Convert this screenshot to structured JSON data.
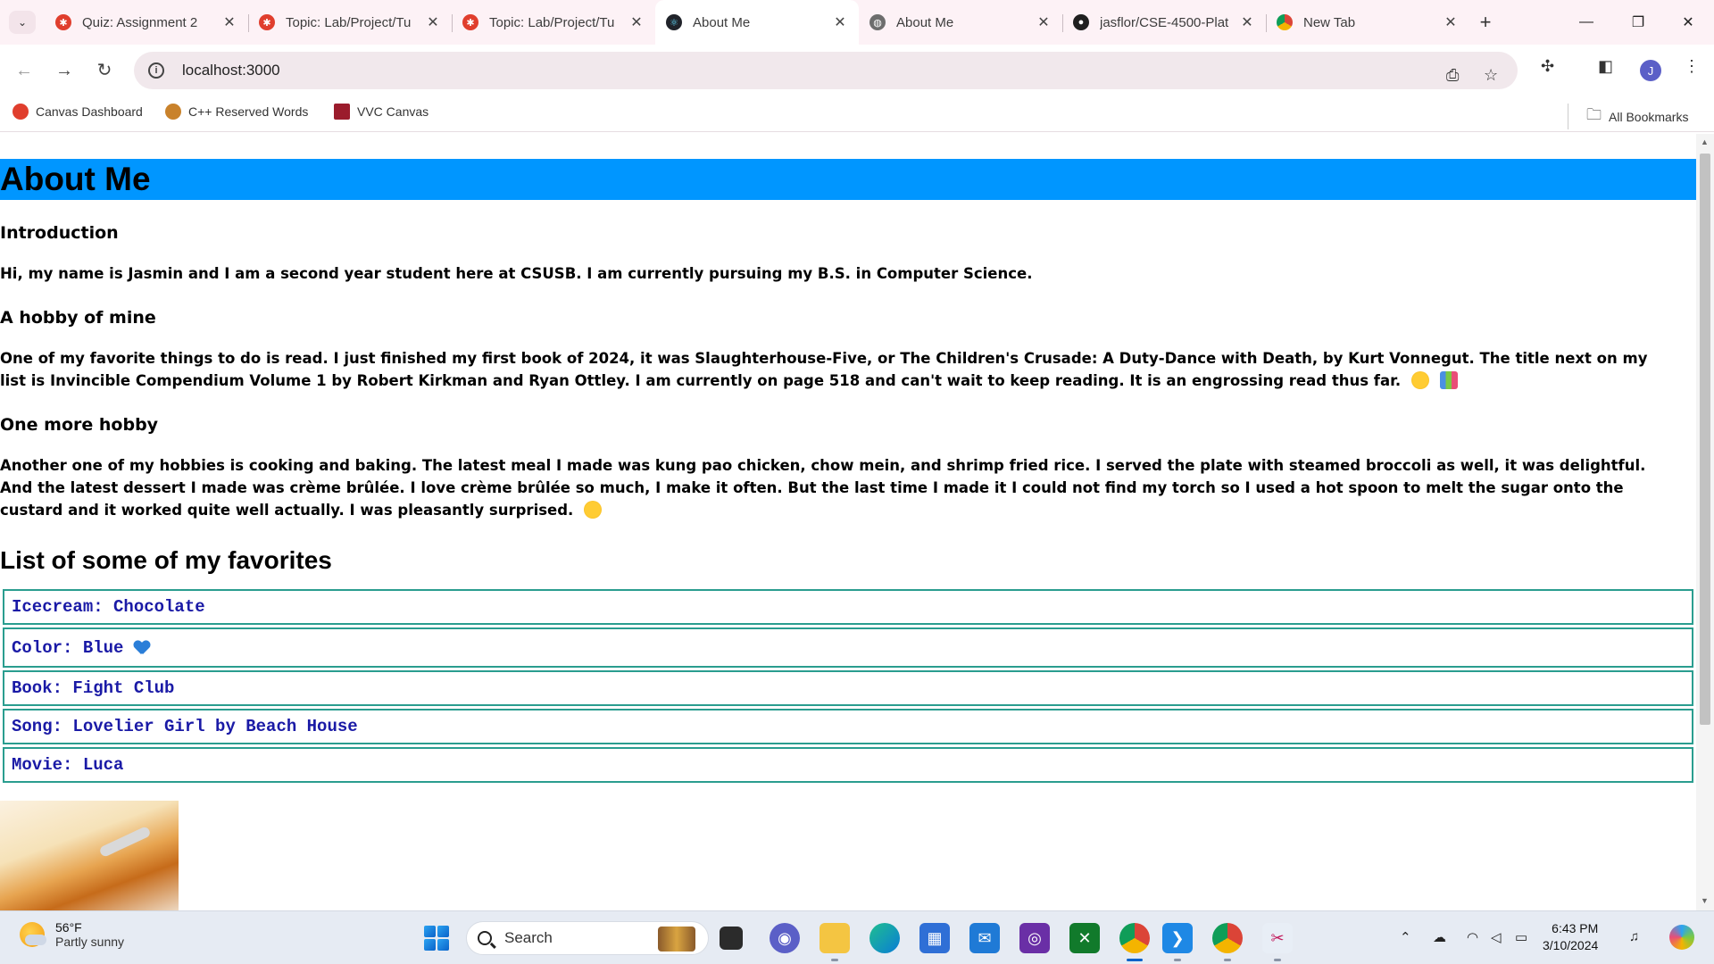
{
  "browser": {
    "tabs": [
      {
        "title": "Quiz: Assignment 2",
        "icon": "canvas-icon",
        "active": false
      },
      {
        "title": "Topic: Lab/Project/Tu",
        "icon": "canvas-icon",
        "active": false
      },
      {
        "title": "Topic: Lab/Project/Tu",
        "icon": "canvas-icon",
        "active": false
      },
      {
        "title": "About Me",
        "icon": "react-icon",
        "active": true
      },
      {
        "title": "About Me",
        "icon": "globe-icon",
        "active": false
      },
      {
        "title": "jasflor/CSE-4500-Plat",
        "icon": "github-icon",
        "active": false
      },
      {
        "title": "New Tab",
        "icon": "chrome-icon",
        "active": false
      }
    ],
    "close_glyph": "✕",
    "new_tab_glyph": "+",
    "url": "localhost:3000",
    "profile_initial": "J",
    "bookmarks": [
      {
        "label": "Canvas Dashboard",
        "icon": "canvas-icon"
      },
      {
        "label": "C++ Reserved Words",
        "icon": "cpp-icon"
      },
      {
        "label": "VVC Canvas",
        "icon": "vvc-icon"
      }
    ],
    "all_bookmarks_label": "All Bookmarks"
  },
  "page": {
    "title": "About Me",
    "sections": [
      {
        "heading": "Introduction",
        "text": "Hi, my name is Jasmin and I am a second year student here at CSUSB. I am currently pursuing my B.S. in Computer Science."
      },
      {
        "heading": "A hobby of mine",
        "text": "One of my favorite things to do is read. I just finished my first book of 2024, it was Slaughterhouse-Five, or The Children's Crusade: A Duty-Dance with Death, by Kurt Vonnegut. The title next on my list is Invincible Compendium Volume 1 by Robert Kirkman and Ryan Ottley. I am currently on page 518 and can't wait to keep reading. It is an engrossing read thus far."
      },
      {
        "heading": "One more hobby",
        "text": "Another one of my hobbies is cooking and baking. The latest meal I made was kung pao chicken, chow mein, and shrimp fried rice. I served the plate with steamed broccoli as well, it was delightful. And the latest dessert I made was crème brûlée. I love crème brûlée so much, I make it often. But the last time I made it I could not find my torch so I used a hot spoon to melt the sugar onto the custard and it worked quite well actually. I was pleasantly surprised."
      }
    ],
    "favorites_heading": "List of some of my favorites",
    "favorites": [
      "Icecream: Chocolate",
      "Color: Blue",
      "Book: Fight Club",
      "Song: Lovelier Girl by Beach House",
      "Movie: Luca"
    ],
    "colors": {
      "title_bar": "#0096ff",
      "list_border": "#2a9d8f",
      "list_text": "#1a1aa6"
    }
  },
  "taskbar": {
    "temperature": "56°F",
    "condition": "Partly sunny",
    "search_placeholder": "Search",
    "time": "6:43 PM",
    "date": "3/10/2024",
    "apps": [
      "task-view-icon",
      "teams-icon",
      "file-explorer-icon",
      "edge-icon",
      "store-icon",
      "mail-icon",
      "app-icon",
      "xbox-icon",
      "chrome-icon",
      "vscode-icon",
      "chrome-icon",
      "snipping-tool-icon"
    ]
  }
}
